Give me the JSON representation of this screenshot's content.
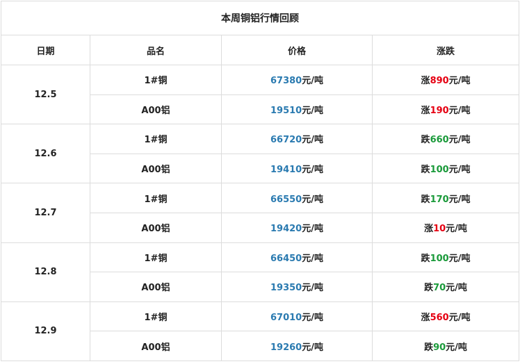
{
  "title": "本周铜铝行情回顾",
  "headers": {
    "date": "日期",
    "product": "品名",
    "price": "价格",
    "change": "涨跌"
  },
  "unit": "元/吨",
  "colors": {
    "price": "#2a7ab0",
    "up": "#e60012",
    "down": "#1a9a3a"
  },
  "rows": [
    {
      "date": "12.5",
      "items": [
        {
          "product": "1#铜",
          "price": "67380",
          "dir": "涨",
          "amount": "890"
        },
        {
          "product": "A00铝",
          "price": "19510",
          "dir": "涨",
          "amount": "190"
        }
      ]
    },
    {
      "date": "12.6",
      "items": [
        {
          "product": "1#铜",
          "price": "66720",
          "dir": "跌",
          "amount": "660"
        },
        {
          "product": "A00铝",
          "price": "19410",
          "dir": "跌",
          "amount": "100"
        }
      ]
    },
    {
      "date": "12.7",
      "items": [
        {
          "product": "1#铜",
          "price": "66550",
          "dir": "跌",
          "amount": "170"
        },
        {
          "product": "A00铝",
          "price": "19420",
          "dir": "涨",
          "amount": "10"
        }
      ]
    },
    {
      "date": "12.8",
      "items": [
        {
          "product": "1#铜",
          "price": "66450",
          "dir": "跌",
          "amount": "100"
        },
        {
          "product": "A00铝",
          "price": "19350",
          "dir": "跌",
          "amount": "70"
        }
      ]
    },
    {
      "date": "12.9",
      "items": [
        {
          "product": "1#铜",
          "price": "67010",
          "dir": "涨",
          "amount": "560"
        },
        {
          "product": "A00铝",
          "price": "19260",
          "dir": "跌",
          "amount": "90"
        }
      ]
    }
  ]
}
